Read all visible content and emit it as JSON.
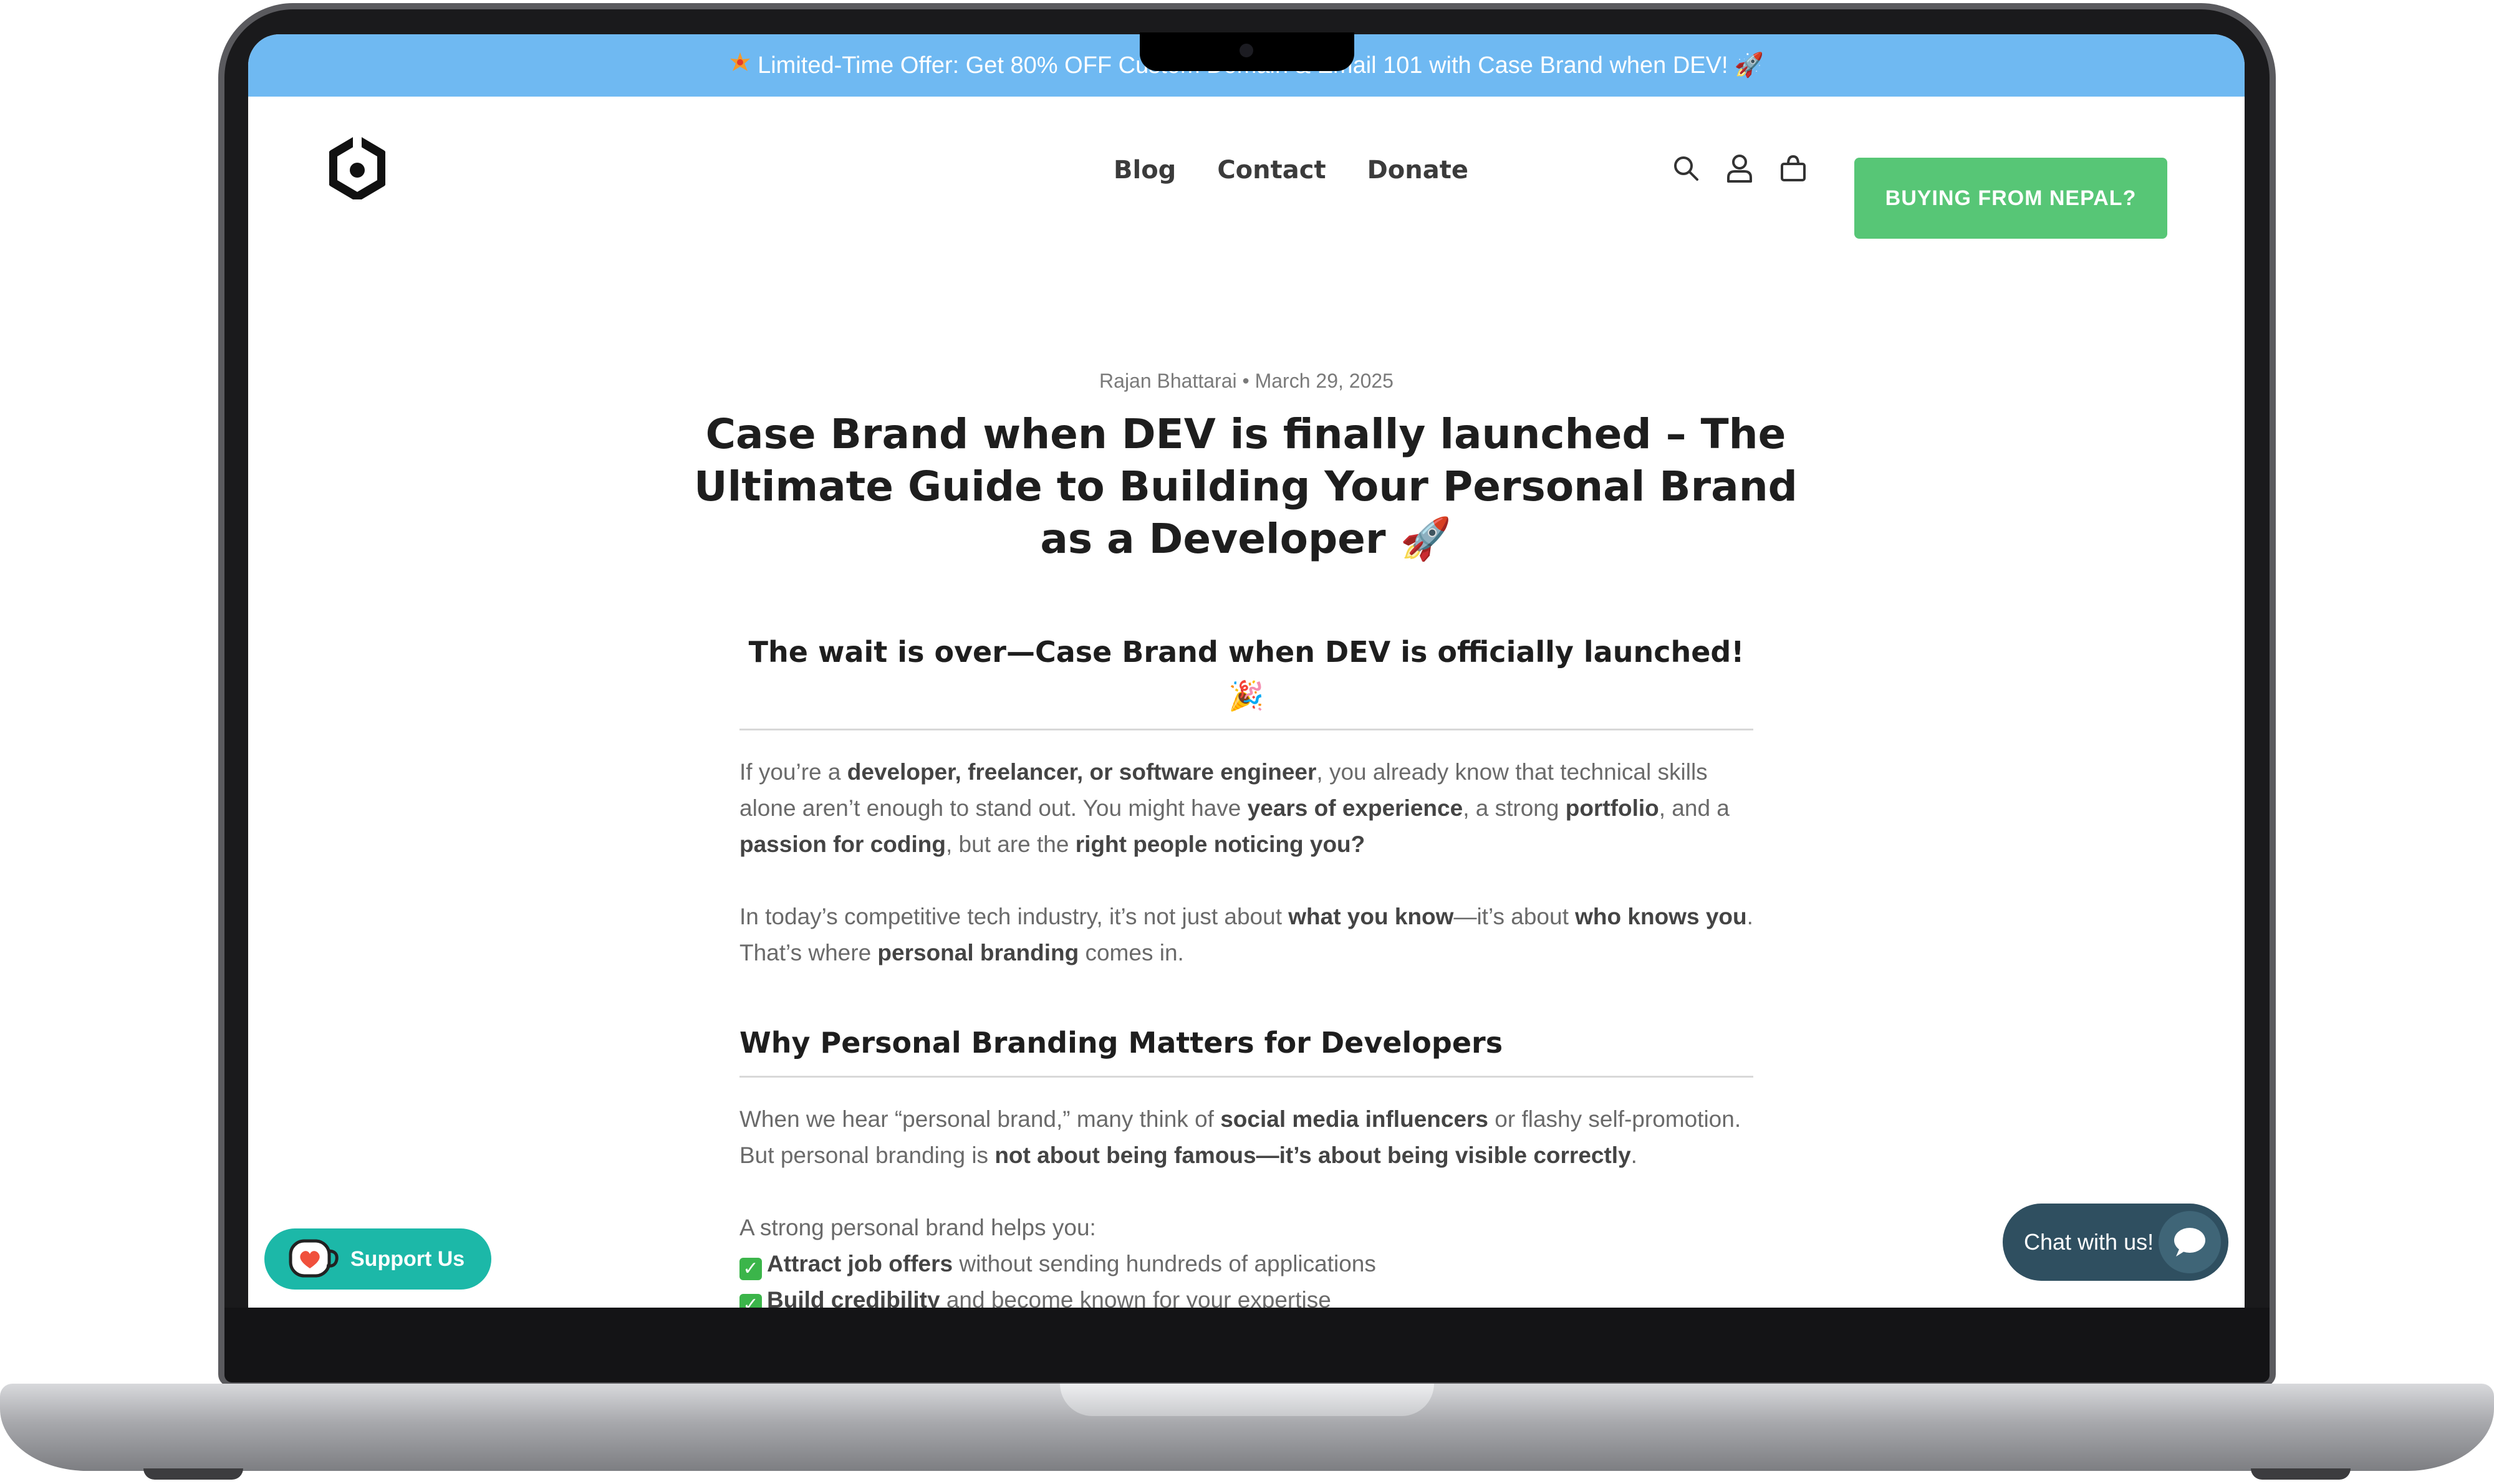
{
  "promo": {
    "icon": "spark-icon",
    "text": "Limited-Time Offer: Get 80% OFF Custom Domain & Email 101 with Case Brand when DEV!",
    "emoji": "🚀"
  },
  "nav": {
    "items": [
      {
        "label": "Blog"
      },
      {
        "label": "Contact"
      },
      {
        "label": "Donate"
      }
    ]
  },
  "header": {
    "logo_icon": "hexagon-logo-icon",
    "icons": [
      "search-icon",
      "account-icon",
      "cart-icon"
    ],
    "cta_label": "BUYING FROM NEPAL?"
  },
  "article": {
    "byline": "Rajan Bhattarai • March 29, 2025",
    "title": "Case Brand when DEV is finally launched – The Ultimate Guide to Building Your Personal Brand as a Developer 🚀",
    "subhead_1": "The wait is over—Case Brand when DEV is officially launched! 🎉",
    "p1": {
      "a": "If you’re a ",
      "b": "developer, freelancer, or software engineer",
      "c": ", you already know that technical skills alone aren’t enough to stand out. You might have ",
      "d": "years of experience",
      "e": ", a strong ",
      "f": "portfolio",
      "g": ", and a ",
      "h": "passion for coding",
      "i": ", but are the ",
      "j": "right people noticing you?"
    },
    "p2": {
      "a": "In today’s competitive tech industry, it’s not just about ",
      "b": "what you know",
      "c": "—it’s about ",
      "d": "who knows you",
      "e": ". That’s where ",
      "f": "personal branding",
      "g": " comes in."
    },
    "subhead_2": "Why Personal Branding Matters for Developers",
    "p3": {
      "a": "When we hear “personal brand,” many think of ",
      "b": "social media influencers",
      "c": " or flashy self-promotion. But personal branding is ",
      "d": "not about being famous—it’s about being visible correctly",
      "e": "."
    },
    "p4_intro": "A strong personal brand helps you:",
    "benefits": [
      {
        "bold": "Attract job offers",
        "rest": " without sending hundreds of applications"
      },
      {
        "bold": "Build credibility",
        "rest": " and become known for your expertise"
      }
    ]
  },
  "widgets": {
    "support_label": "Support Us",
    "support_icon": "heart-cup-icon",
    "chat_label": "Chat with us!",
    "chat_icon": "chat-bubble-icon"
  },
  "colors": {
    "promo_bar": "#6fb9f2",
    "cta_green": "#57c676",
    "support_teal": "#1cb8a8",
    "chat_dark": "#2f4f60"
  }
}
